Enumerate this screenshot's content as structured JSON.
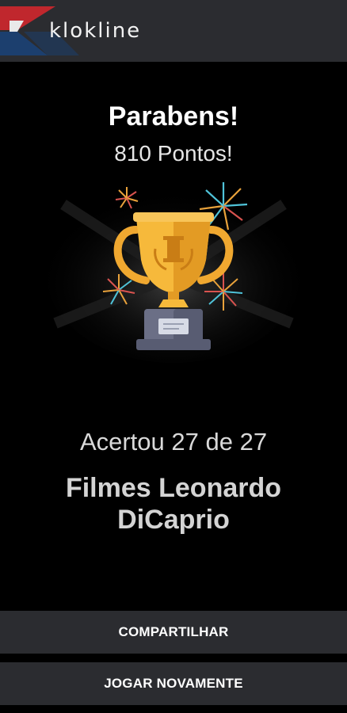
{
  "header": {
    "logo_text": "klokline",
    "logo_icon": "klokline-logo-mark",
    "colors": {
      "background": "#2b2c30",
      "logo_red": "#c0272d",
      "logo_blue": "#1c3f6e"
    }
  },
  "result": {
    "title": "Parabens!",
    "points": "810 Pontos!",
    "score": "Acertou 27 de 27",
    "quiz_name": "Filmes Leonardo DiCaprio",
    "illustration": "trophy-icon"
  },
  "actions": {
    "share_label": "COMPARTILHAR",
    "play_again_label": "JOGAR NOVAMENTE"
  }
}
